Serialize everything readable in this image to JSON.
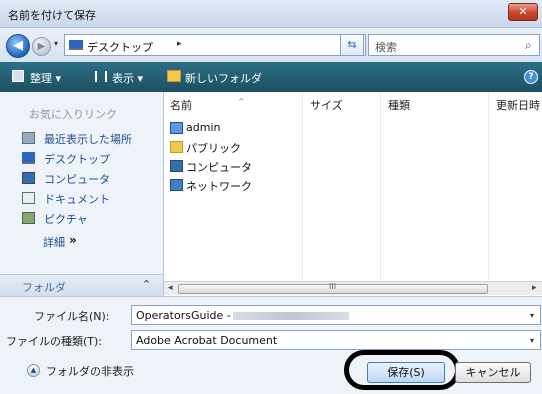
{
  "window": {
    "title": "名前を付けて保存",
    "close_label": "✕"
  },
  "address_bar": {
    "path_label": "デスクトップ",
    "path_arrow": "▸",
    "dropdown_glyph": "▾",
    "refresh_glyph": "⇆",
    "search_placeholder": "検索",
    "search_glyph": "⌕"
  },
  "nav": {
    "back_glyph": "◀",
    "forward_glyph": "▶",
    "history_glyph": "▾"
  },
  "toolbar": {
    "organize_label": "整理 ▾",
    "view_label": "表示 ▾",
    "new_folder_label": "新しいフォルダ",
    "help_glyph": "?"
  },
  "sidebar": {
    "header": "お気に入りリンク",
    "items": [
      {
        "label": "最近表示した場所",
        "icon": "recent-places-icon"
      },
      {
        "label": "デスクトップ",
        "icon": "desktop-icon"
      },
      {
        "label": "コンピュータ",
        "icon": "computer-icon"
      },
      {
        "label": "ドキュメント",
        "icon": "documents-icon"
      },
      {
        "label": "ピクチャ",
        "icon": "pictures-icon"
      }
    ],
    "more_label": "詳細",
    "more_glyph": "»",
    "folders_label": "フォルダ",
    "folders_chevron": "⌃"
  },
  "file_list": {
    "columns": [
      "名前",
      "サイズ",
      "種類",
      "更新日時"
    ],
    "sort_glyph": "^",
    "items": [
      {
        "label": "admin",
        "icon": "user-folder-icon"
      },
      {
        "label": "パブリック",
        "icon": "public-folder-icon"
      },
      {
        "label": "コンピュータ",
        "icon": "computer-icon"
      },
      {
        "label": "ネットワーク",
        "icon": "network-icon"
      }
    ],
    "scroll_left": "◂",
    "scroll_grip": "III",
    "scroll_right": "▸"
  },
  "form": {
    "filename_label": "ファイル名(N):",
    "filename_value": "OperatorsGuide -",
    "filetype_label": "ファイルの種類(T):",
    "filetype_value": "Adobe Acrobat Document",
    "dropdown_glyph": "▾",
    "hide_folders_label": "フォルダの非表示",
    "hide_folders_glyph": "▲",
    "save_label": "保存(S)",
    "cancel_label": "キャンセル"
  },
  "colors": {
    "toolbar": "#1c4f62",
    "link": "#1d4f91",
    "close": "#c8452a",
    "highlight_ring": "#000000"
  }
}
